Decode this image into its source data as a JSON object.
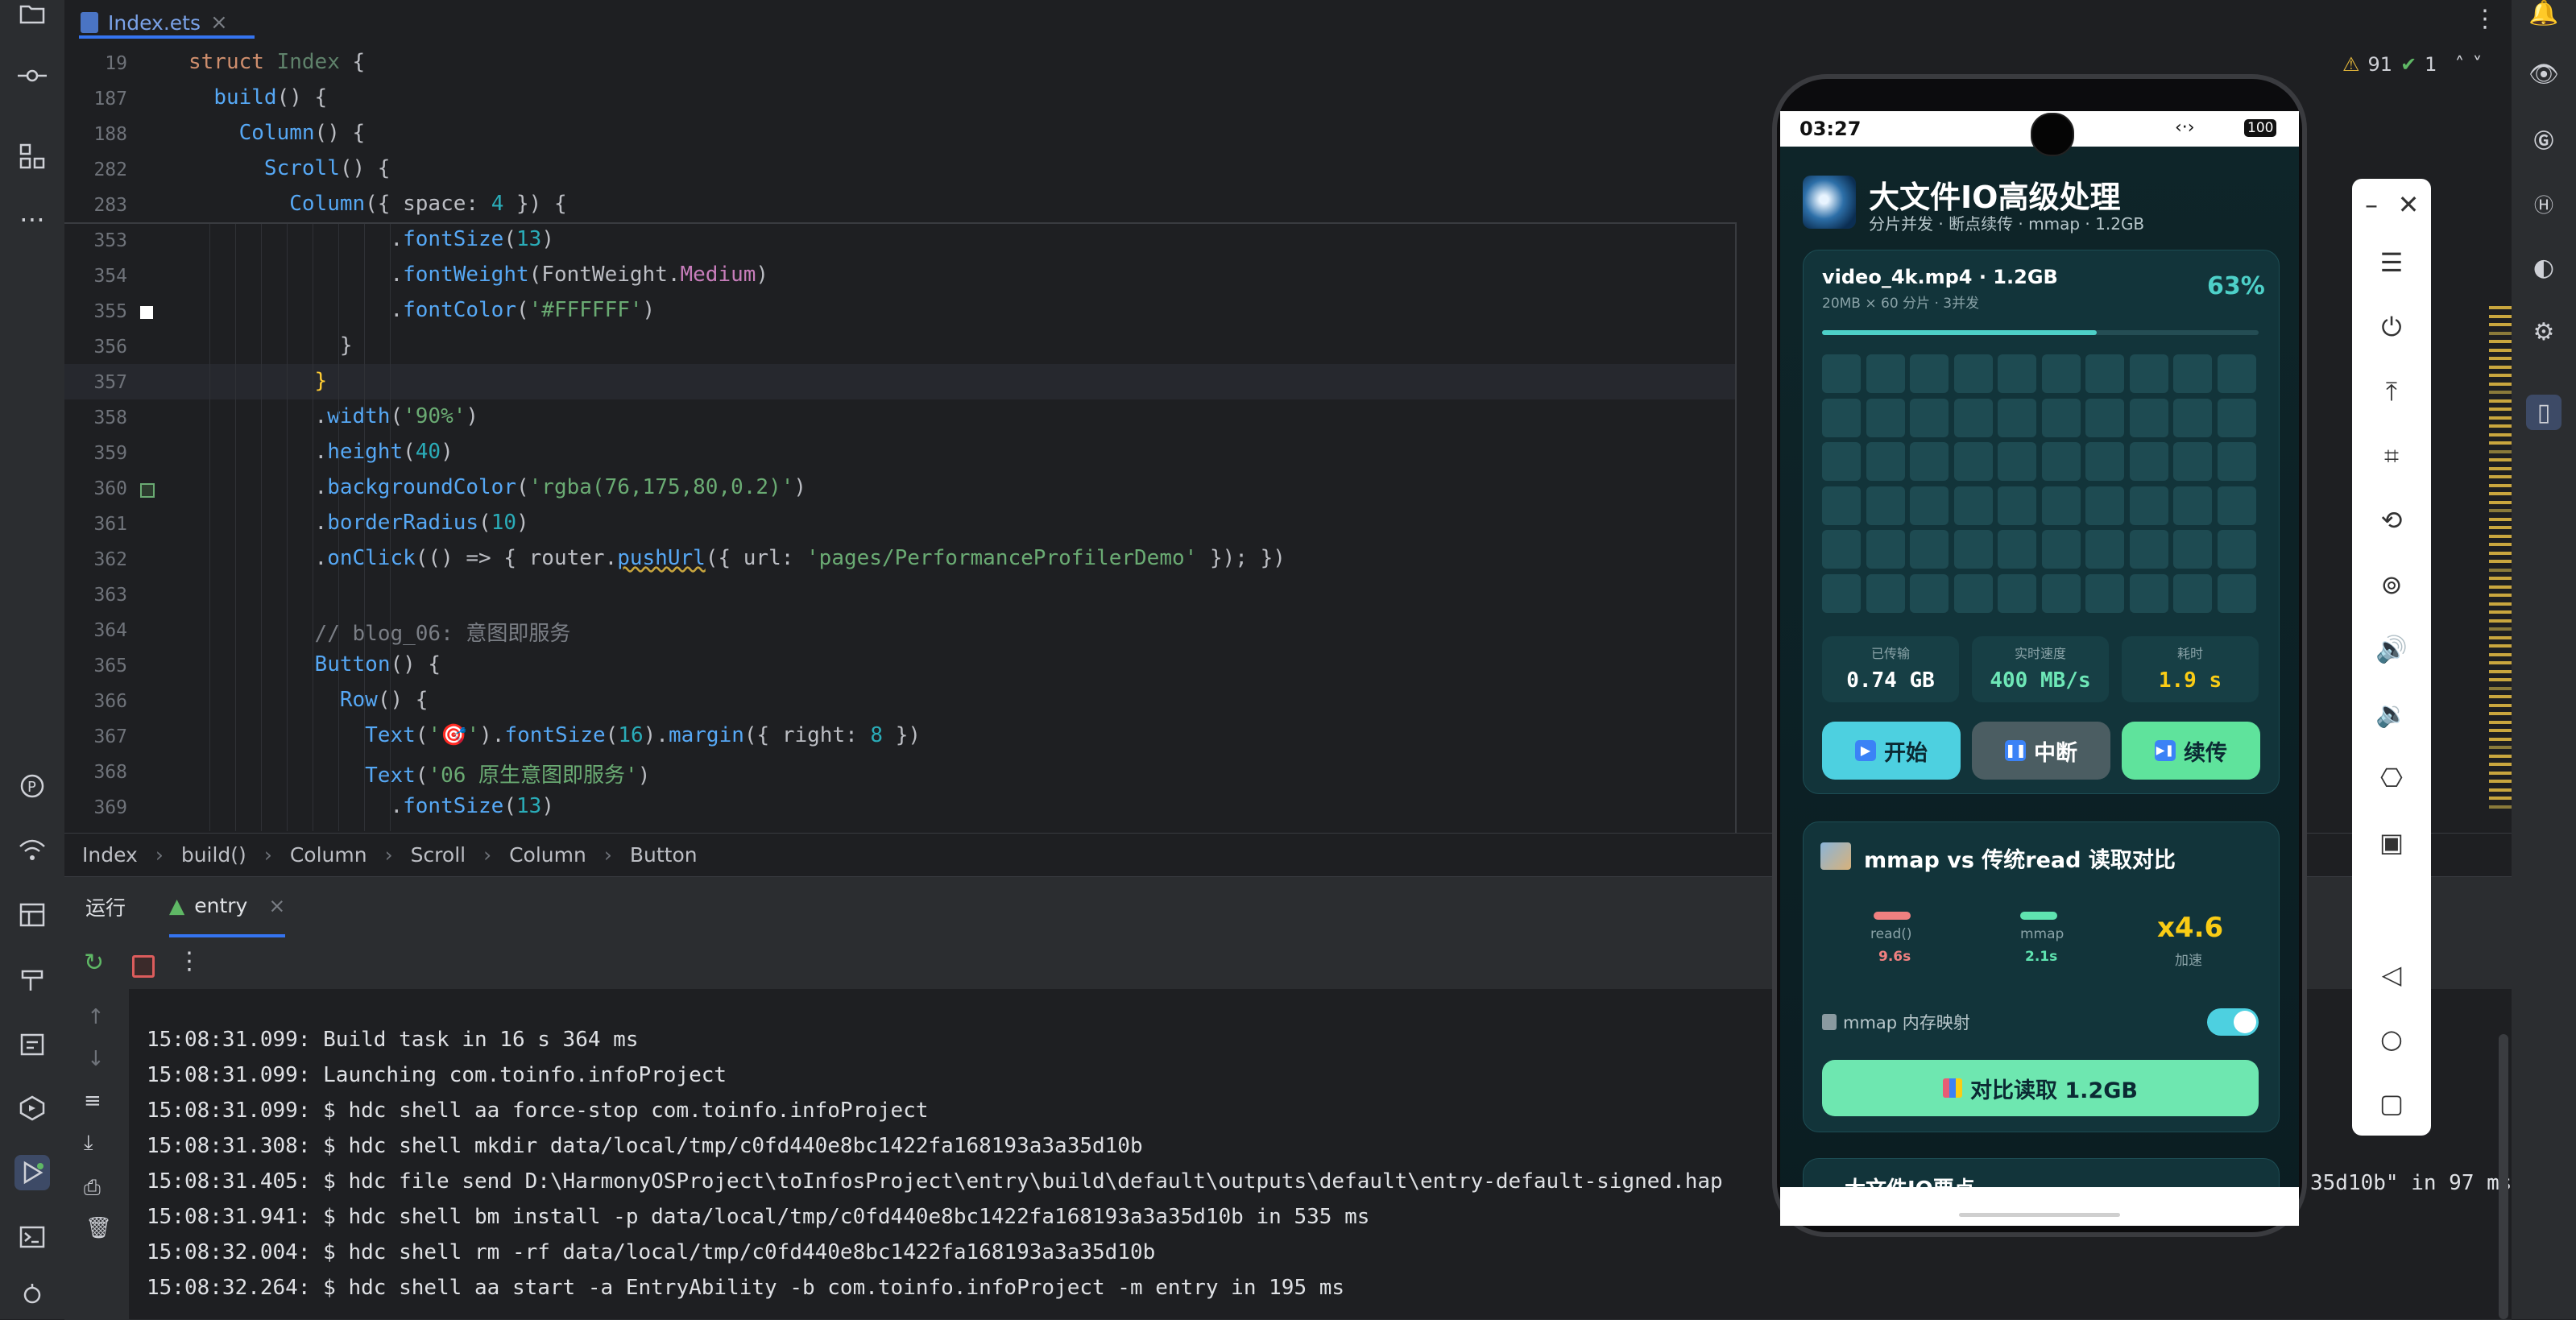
{
  "tab": {
    "label": "Index.ets",
    "close": "×"
  },
  "left_bar_icons": [
    "folder-icon",
    "commit-icon",
    "structure-icon",
    "more-icon",
    "plugin-icon",
    "hot-reload-icon",
    "layout-icon",
    "build-icon",
    "calendar-icon",
    "services-icon",
    "run-icon",
    "terminal-icon",
    "bug-icon"
  ],
  "right_bar_icons": [
    "notifications-icon",
    "eye-icon",
    "g-icon",
    "h-icon",
    "chart-icon",
    "robot-icon",
    "device-icon"
  ],
  "inspections": {
    "warnings": "91",
    "ok": "1"
  },
  "sticky_lines": [
    {
      "num": "19",
      "html": "<span class=\"kw\">struct</span> <span class=\"ty\" style=\"color:#5f826b\">Index</span> {"
    },
    {
      "num": "187",
      "html": "  <span class=\"fn\">build</span>() {"
    },
    {
      "num": "188",
      "html": "    <span class=\"fn\">Column</span>() {"
    },
    {
      "num": "282",
      "html": "      <span class=\"fn\">Scroll</span>() {"
    },
    {
      "num": "283",
      "html": "        <span class=\"fn\">Column</span>({ space: <span class=\"nm\">4</span> }) {"
    }
  ],
  "code_lines": [
    {
      "num": "353",
      "html": "                .<span class=\"fn\">fontSize</span>(<span class=\"nm\">13</span>)"
    },
    {
      "num": "354",
      "html": "                .<span class=\"fn\">fontWeight</span>(FontWeight.<span class=\"pr\">Medium</span>)"
    },
    {
      "num": "355",
      "html": "                .<span class=\"fn\">fontColor</span>(<span class=\"st\">'#FFFFFF'</span>)"
    },
    {
      "num": "356",
      "html": "            }"
    },
    {
      "num": "357",
      "html": "          <span style=\"color:#ffcc33\">}</span>"
    },
    {
      "num": "358",
      "html": "          .<span class=\"fn\">width</span>(<span class=\"st\">'90%'</span>)"
    },
    {
      "num": "359",
      "html": "          .<span class=\"fn\">height</span>(<span class=\"nm\">40</span>)"
    },
    {
      "num": "360",
      "html": "          .<span class=\"fn\">backgroundColor</span>(<span class=\"st\">'rgba(76,175,80,0.2)'</span>)"
    },
    {
      "num": "361",
      "html": "          .<span class=\"fn\">borderRadius</span>(<span class=\"nm\">10</span>)"
    },
    {
      "num": "362",
      "html": "          .<span class=\"fn\">onClick</span>(() => { router.<span class=\"fn\" style=\"text-decoration:underline wavy #c9a63e\">pushUrl</span>({ url: <span class=\"st\">'pages/PerformanceProfilerDemo'</span> }); })"
    },
    {
      "num": "363",
      "html": ""
    },
    {
      "num": "364",
      "html": "          <span class=\"cm\">// blog_06: 意图即服务</span>"
    },
    {
      "num": "365",
      "html": "          <span class=\"fn\">Button</span>() {"
    },
    {
      "num": "366",
      "html": "            <span class=\"fn\">Row</span>() {"
    },
    {
      "num": "367",
      "html": "              <span class=\"fn\">Text</span>(<span class=\"st\">'🎯'</span>).<span class=\"fn\">fontSize</span>(<span class=\"nm\">16</span>).<span class=\"fn\">margin</span>({ right: <span class=\"nm\">8</span> })"
    },
    {
      "num": "368",
      "html": "              <span class=\"fn\">Text</span>(<span class=\"st\">'06 原生意图即服务'</span>)"
    },
    {
      "num": "369",
      "html": "                .<span class=\"fn\">fontSize</span>(<span class=\"nm\">13</span>)"
    }
  ],
  "breadcrumb": [
    "Index",
    "build()",
    "Column",
    "Scroll",
    "Column",
    "Button"
  ],
  "run_panel": {
    "tab_run": "运行",
    "tab_entry": "entry",
    "close": "×"
  },
  "console_lines": [
    "15:08:31.099: Build task in 16 s 364 ms",
    "15:08:31.099: Launching com.toinfo.infoProject",
    "15:08:31.099: $ hdc shell aa force-stop com.toinfo.infoProject",
    "15:08:31.308: $ hdc shell mkdir data/local/tmp/c0fd440e8bc1422fa168193a3a35d10b",
    "15:08:31.405: $ hdc file send D:\\HarmonyOSProject\\toInfosProject\\entry\\build\\default\\outputs\\default\\entry-default-signed.hap",
    "15:08:31.941: $ hdc shell bm install -p data/local/tmp/c0fd440e8bc1422fa168193a3a35d10b in 535 ms",
    "15:08:32.004: $ hdc shell rm -rf data/local/tmp/c0fd440e8bc1422fa168193a3a35d10b",
    "15:08:32.264: $ hdc shell aa start -a EntryAbility -b com.toinfo.infoProject -m entry in 195 ms"
  ],
  "console_overflow": "35d10b\" in 97 ms",
  "phone": {
    "time": "03:27",
    "battery": "100",
    "app_title": "大文件IO高级处理",
    "app_subtitle": "分片并发 · 断点续传 · mmap · 1.2GB",
    "file_name": "video_4k.mp4 · 1.2GB",
    "file_meta": "20MB × 60 分片 · 3并发",
    "progress_text": "63%",
    "progress": 0.63,
    "stats": [
      {
        "label": "已传输",
        "value": "0.74 GB",
        "color": "#ffffff"
      },
      {
        "label": "实时速度",
        "value": "400 MB/s",
        "color": "#6ee7b7"
      },
      {
        "label": "耗时",
        "value": "1.9 s",
        "color": "#facc15"
      }
    ],
    "buttons": {
      "start": "开始",
      "pause": "中断",
      "resume": "续传"
    },
    "compare_title": "mmap vs 传统read 读取对比",
    "read_label": "read()",
    "read_time": "9.6s",
    "mmap_label": "mmap",
    "mmap_time": "2.1s",
    "speedup": "x4.6",
    "speedup_label": "加速",
    "toggle_label": "mmap 内存映射",
    "toggle_on": true,
    "compare_button": "对比读取 1.2GB",
    "next_card_peek": "大文件IO要点"
  },
  "emulator_controls": [
    "minimize-icon",
    "close-icon",
    "menu-icon",
    "power-icon",
    "top-icon",
    "crop-icon",
    "rotate-icon",
    "rotate-lock-icon",
    "volume-up-icon",
    "volume-down-icon",
    "shake-icon",
    "screen-record-icon",
    "back-icon",
    "home-icon",
    "recents-icon"
  ]
}
